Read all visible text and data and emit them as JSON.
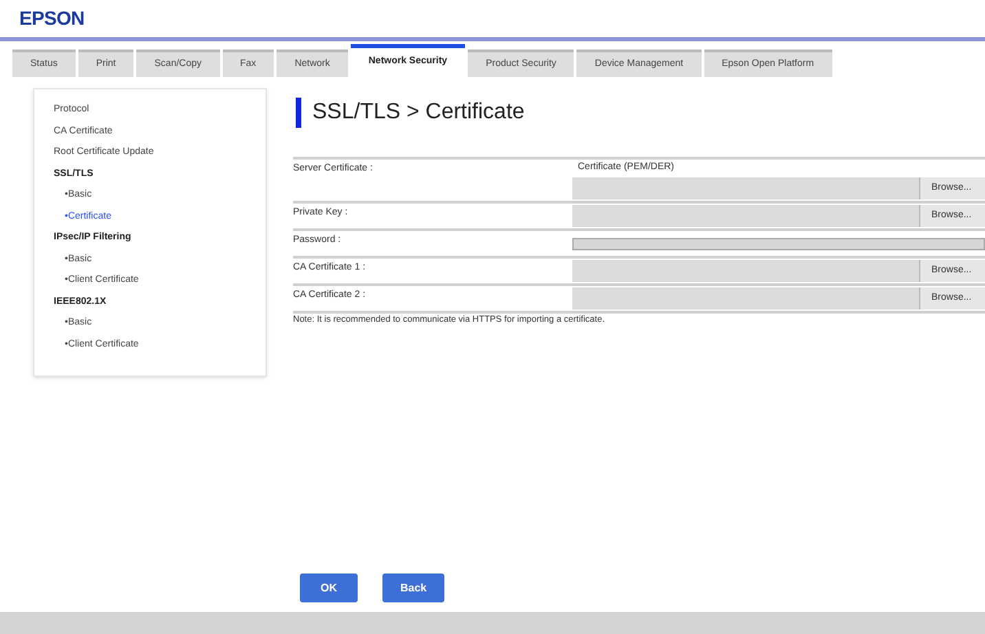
{
  "logo": "EPSON",
  "tabs": [
    {
      "label": "Status",
      "selected": false
    },
    {
      "label": "Print",
      "selected": false
    },
    {
      "label": "Scan/Copy",
      "selected": false
    },
    {
      "label": "Fax",
      "selected": false
    },
    {
      "label": "Network",
      "selected": false
    },
    {
      "label": "Network Security",
      "selected": true
    },
    {
      "label": "Product Security",
      "selected": false
    },
    {
      "label": "Device Management",
      "selected": false
    },
    {
      "label": "Epson Open Platform",
      "selected": false
    }
  ],
  "sidebar": {
    "items": [
      {
        "label": "Protocol",
        "selected": false
      },
      {
        "label": "CA Certificate",
        "selected": false
      },
      {
        "label": "Root Certificate Update",
        "selected": false
      },
      {
        "label": "SSL/TLS",
        "selected": false,
        "children": [
          {
            "label": "•Basic",
            "selected": false
          },
          {
            "label": "•Certificate",
            "selected": true
          }
        ]
      },
      {
        "label": "IPsec/IP Filtering",
        "selected": false,
        "children": [
          {
            "label": "•Basic",
            "selected": false
          },
          {
            "label": "•Client Certificate",
            "selected": false
          }
        ]
      },
      {
        "label": "IEEE802.1X",
        "selected": false,
        "children": [
          {
            "label": "•Basic",
            "selected": false
          },
          {
            "label": "•Client Certificate",
            "selected": false
          }
        ]
      }
    ]
  },
  "title": "SSL/TLS > Certificate",
  "form": {
    "rows": [
      {
        "kind": "select_file",
        "label": "Server Certificate :",
        "value": "Certificate (PEM/DER)",
        "button": "Browse..."
      },
      {
        "kind": "file",
        "label": "Private Key :",
        "button": "Browse..."
      },
      {
        "kind": "password",
        "label": "Password :"
      },
      {
        "kind": "file",
        "label": "CA Certificate 1 :",
        "button": "Browse..."
      },
      {
        "kind": "file",
        "label": "CA Certificate 2 :",
        "button": "Browse..."
      }
    ],
    "note": "Note: It is recommended to communicate via HTTPS for importing a certificate."
  },
  "buttons": [
    "OK",
    "Back"
  ]
}
